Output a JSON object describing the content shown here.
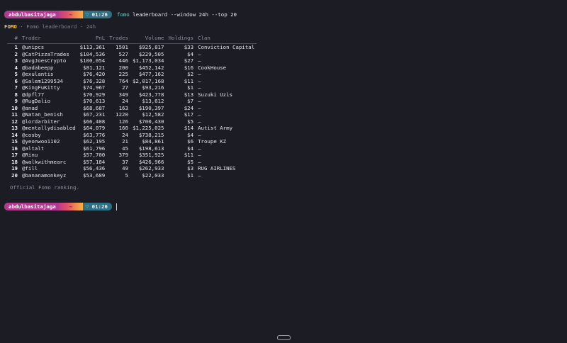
{
  "prompt": {
    "user": "abdulbasitajaga",
    "git": "~",
    "time": "♡ 01:26"
  },
  "command": {
    "bin": "fomo",
    "args": " leaderboard --window 24h --top 20"
  },
  "header": {
    "brand": "FOMO",
    "sep1": "·",
    "title": "Fomo leaderboard",
    "sep2": "·",
    "window": "24h"
  },
  "table": {
    "columns": [
      "#",
      "Trader",
      "PnL",
      "Trades",
      "Volume",
      "Holdings",
      "Clan"
    ],
    "rows": [
      {
        "rank": "1",
        "trader": "@unipcs",
        "pnl": "$113,361",
        "trades": "1501",
        "volume": "$925,817",
        "holdings": "$33",
        "clan": "Conviction Capital"
      },
      {
        "rank": "2",
        "trader": "@CatPizzaTrades",
        "pnl": "$104,536",
        "trades": "527",
        "volume": "$229,505",
        "holdings": "$4",
        "clan": "–"
      },
      {
        "rank": "3",
        "trader": "@AvgJoesCrypto",
        "pnl": "$100,054",
        "trades": "446",
        "volume": "$1,173,034",
        "holdings": "$27",
        "clan": "–"
      },
      {
        "rank": "4",
        "trader": "@badabeepp",
        "pnl": "$81,121",
        "trades": "200",
        "volume": "$452,142",
        "holdings": "$16",
        "clan": "CookHouse"
      },
      {
        "rank": "5",
        "trader": "@exulantis",
        "pnl": "$76,420",
        "trades": "225",
        "volume": "$477,162",
        "holdings": "$2",
        "clan": "–"
      },
      {
        "rank": "6",
        "trader": "@Salem1299534",
        "pnl": "$76,328",
        "trades": "764",
        "volume": "$2,017,168",
        "holdings": "$11",
        "clan": "–"
      },
      {
        "rank": "7",
        "trader": "@KingFuKitty",
        "pnl": "$74,967",
        "trades": "27",
        "volume": "$93,216",
        "holdings": "$1",
        "clan": "–"
      },
      {
        "rank": "8",
        "trader": "@dpfl77",
        "pnl": "$70,929",
        "trades": "349",
        "volume": "$423,778",
        "holdings": "$13",
        "clan": "Suzuki Uzis"
      },
      {
        "rank": "9",
        "trader": "@RugDalio",
        "pnl": "$70,613",
        "trades": "24",
        "volume": "$13,612",
        "holdings": "$7",
        "clan": "–"
      },
      {
        "rank": "10",
        "trader": "@anad",
        "pnl": "$68,687",
        "trades": "163",
        "volume": "$190,397",
        "holdings": "$24",
        "clan": "–"
      },
      {
        "rank": "11",
        "trader": "@Natan_benish",
        "pnl": "$67,231",
        "trades": "1220",
        "volume": "$12,582",
        "holdings": "$17",
        "clan": "–"
      },
      {
        "rank": "12",
        "trader": "@lordarbiter",
        "pnl": "$66,408",
        "trades": "126",
        "volume": "$700,430",
        "holdings": "$5",
        "clan": "–"
      },
      {
        "rank": "13",
        "trader": "@mentallydisabled",
        "pnl": "$64,079",
        "trades": "160",
        "volume": "$1,225,025",
        "holdings": "$14",
        "clan": "Autist Army"
      },
      {
        "rank": "14",
        "trader": "@cosby",
        "pnl": "$63,776",
        "trades": "24",
        "volume": "$738,215",
        "holdings": "$4",
        "clan": "–"
      },
      {
        "rank": "15",
        "trader": "@yeonwoo1102",
        "pnl": "$62,195",
        "trades": "21",
        "volume": "$84,861",
        "holdings": "$6",
        "clan": "Troupe KZ"
      },
      {
        "rank": "16",
        "trader": "@altalt",
        "pnl": "$61,796",
        "trades": "45",
        "volume": "$198,613",
        "holdings": "$4",
        "clan": "–"
      },
      {
        "rank": "17",
        "trader": "@Rinu",
        "pnl": "$57,700",
        "trades": "379",
        "volume": "$351,925",
        "holdings": "$11",
        "clan": "–"
      },
      {
        "rank": "18",
        "trader": "@walkwithmearc",
        "pnl": "$57,184",
        "trades": "37",
        "volume": "$426,966",
        "holdings": "$5",
        "clan": "–"
      },
      {
        "rank": "19",
        "trader": "@fill",
        "pnl": "$56,436",
        "trades": "49",
        "volume": "$262,933",
        "holdings": "$3",
        "clan": "RUG AIRLINES"
      },
      {
        "rank": "20",
        "trader": "@bananamonkeyz",
        "pnl": "$53,689",
        "trades": "5",
        "volume": "$22,033",
        "holdings": "$1",
        "clan": "–"
      }
    ]
  },
  "footnote": "Official Fomo ranking.",
  "colors": {
    "background": "#1c1d24",
    "brand": "#f6c343",
    "command": "#6bd6d0",
    "user_segment": "#b03a8e",
    "time_segment": "#2f6f83"
  }
}
